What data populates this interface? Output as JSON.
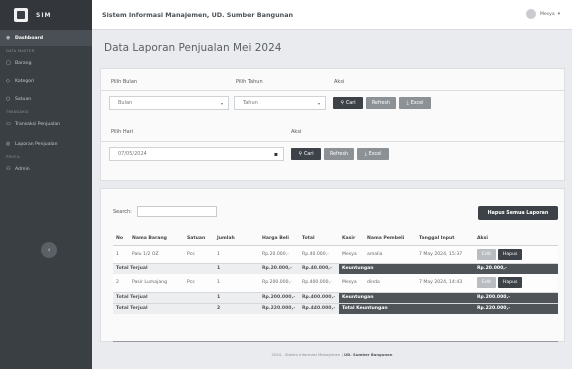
{
  "brand": {
    "name": "SIM"
  },
  "sidebar": {
    "items": [
      {
        "label": "Dashboard",
        "icon": "dashboard-icon"
      },
      {
        "section": "DATA MASTER"
      },
      {
        "label": "Barang",
        "icon": "box-icon"
      },
      {
        "label": "Kategori",
        "icon": "tag-icon"
      },
      {
        "label": "Satuan",
        "icon": "unit-icon"
      },
      {
        "section": "TRANSAKSI"
      },
      {
        "label": "Transaksi Penjualan",
        "icon": "cart-icon"
      },
      {
        "label": "Laporan Penjualan",
        "icon": "report-icon"
      },
      {
        "section": "PROFIL"
      },
      {
        "label": "Admin",
        "icon": "user-icon"
      }
    ]
  },
  "topbar": {
    "title": "Sistem Informasi Manajemen, UD. Sumber Bangunan",
    "user": "Mesya"
  },
  "page": {
    "title": "Data Laporan Penjualan Mei 2024"
  },
  "filter_month": {
    "label_bulan": "Pilih Bulan",
    "label_tahun": "Pilih Tahun",
    "label_aksi": "Aksi",
    "bulan_value": "Bulan",
    "tahun_value": "Tahun",
    "cari": "Cari",
    "refresh": "Refresh",
    "excel": "Excel"
  },
  "filter_day": {
    "label_hari": "Pilih Hari",
    "label_aksi": "Aksi",
    "date_value": "07/05/2024",
    "cari": "Cari",
    "refresh": "Refresh",
    "excel": "Excel"
  },
  "table": {
    "search_label": "Search:",
    "hapus_semua": "Hapus Semua Laporan",
    "headers": [
      "No",
      "Nama Barang",
      "Satuan",
      "Jumlah",
      "Harga Beli",
      "Total",
      "Kasir",
      "Nama Pembeli",
      "Tanggal Input",
      "Aksi"
    ],
    "rows": [
      {
        "no": "1",
        "nama": "Palu 1/2 OZ",
        "satuan": "Pcs",
        "jumlah": "1",
        "harga": "Rp.20.000,-",
        "total": "Rp.40.000,-",
        "kasir": "Mesya",
        "pembeli": "amalia",
        "tanggal": "7 May 2024, 15:37",
        "edit": "Edit",
        "hapus": "Hapus",
        "sum_label": "Total Terjual",
        "sum_jumlah": "1",
        "sum_harga": "Rp.20.000,-",
        "sum_total": "Rp.40.000,-",
        "keu_label": "Keuntungan",
        "keu_value": "Rp.20.000,-"
      },
      {
        "no": "2",
        "nama": "Pasir Lumajang",
        "satuan": "Pcs",
        "jumlah": "1",
        "harga": "Rp.200.000,-",
        "total": "Rp.400.000,-",
        "kasir": "Mesya",
        "pembeli": "dinda",
        "tanggal": "7 May 2024, 14:43",
        "edit": "Edit",
        "hapus": "Hapus",
        "sum_label": "Total Terjual",
        "sum_jumlah": "1",
        "sum_harga": "Rp.200.000,-",
        "sum_total": "Rp.400.000,-",
        "keu_label": "Keuntungan",
        "keu_value": "Rp.200.000,-"
      }
    ],
    "grand": {
      "label": "Total Terjual",
      "jumlah": "2",
      "harga": "Rp.220.000,-",
      "total": "Rp.440.000,-",
      "keu_label": "Total Keuntungan",
      "keu_value": "Rp.220.000,-"
    }
  },
  "footer": {
    "text": "2024 - Sistem Informasi Manajemen |",
    "brand": "UD. Sumber Bangunan"
  }
}
